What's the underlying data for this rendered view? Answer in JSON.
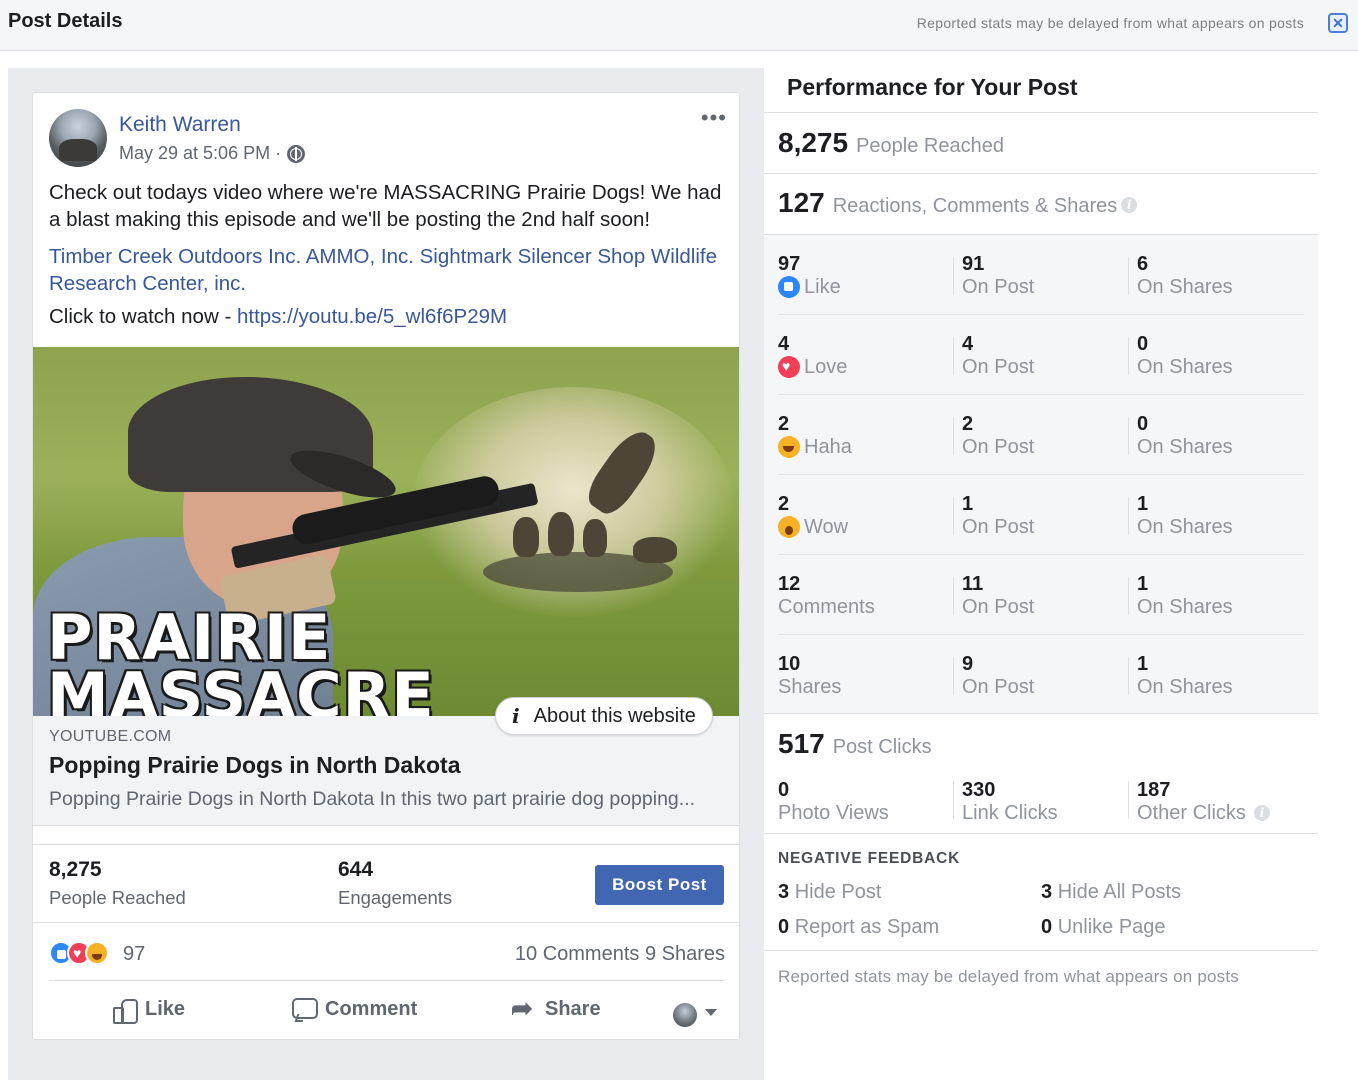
{
  "header": {
    "title": "Post Details",
    "note": "Reported stats may be delayed from what appears on posts",
    "close_icon": "close-icon"
  },
  "post": {
    "author": "Keith Warren",
    "timestamp": "May 29 at 5:06 PM ·",
    "more_label": "•••",
    "text": "Check out todays video where we're MASSACRING Prairie Dogs! We had a blast making this episode and we'll be posting the 2nd half soon!",
    "tags": "Timber Creek Outdoors Inc. AMMO, Inc. Sightmark Silencer Shop Wildlife Research Center, inc.",
    "watch_prefix": "Click to watch now - ",
    "watch_link": "https://youtu.be/5_wl6f6P29M",
    "thumbnail_text_line1": "PRAIRIE",
    "thumbnail_text_line2": "MASSACRE",
    "about_website": "About this website",
    "link": {
      "domain": "YOUTUBE.COM",
      "title": "Popping Prairie Dogs in North Dakota",
      "description": "Popping Prairie Dogs in North Dakota In this two part prairie dog popping..."
    },
    "stats": {
      "reached_value": "8,275",
      "reached_label": "People Reached",
      "engagements_value": "644",
      "engagements_label": "Engagements",
      "boost_label": "Boost Post"
    },
    "reactions_count": "97",
    "comments_shares": "10 Comments  9 Shares",
    "actions": {
      "like": "Like",
      "comment": "Comment",
      "share": "Share"
    }
  },
  "performance": {
    "title": "Performance for Your Post",
    "reached_value": "8,275",
    "reached_label": "People Reached",
    "engagement_value": "127",
    "engagement_label": "Reactions, Comments & Shares",
    "breakdown": [
      {
        "total": "97",
        "label": "Like",
        "icon": "like",
        "on_post": "91",
        "on_post_label": "On Post",
        "on_shares": "6",
        "on_shares_label": "On Shares"
      },
      {
        "total": "4",
        "label": "Love",
        "icon": "love",
        "on_post": "4",
        "on_post_label": "On Post",
        "on_shares": "0",
        "on_shares_label": "On Shares"
      },
      {
        "total": "2",
        "label": "Haha",
        "icon": "haha",
        "on_post": "2",
        "on_post_label": "On Post",
        "on_shares": "0",
        "on_shares_label": "On Shares"
      },
      {
        "total": "2",
        "label": "Wow",
        "icon": "wow",
        "on_post": "1",
        "on_post_label": "On Post",
        "on_shares": "1",
        "on_shares_label": "On Shares"
      },
      {
        "total": "12",
        "label": "Comments",
        "icon": "",
        "on_post": "11",
        "on_post_label": "On Post",
        "on_shares": "1",
        "on_shares_label": "On Shares"
      },
      {
        "total": "10",
        "label": "Shares",
        "icon": "",
        "on_post": "9",
        "on_post_label": "On Post",
        "on_shares": "1",
        "on_shares_label": "On Shares"
      }
    ],
    "clicks_value": "517",
    "clicks_label": "Post Clicks",
    "clicks": {
      "photo_views_value": "0",
      "photo_views_label": "Photo Views",
      "link_clicks_value": "330",
      "link_clicks_label": "Link Clicks",
      "other_clicks_value": "187",
      "other_clicks_label": "Other Clicks"
    },
    "negative": {
      "title": "NEGATIVE FEEDBACK",
      "hide_post_value": "3",
      "hide_post_label": "Hide Post",
      "hide_all_value": "3",
      "hide_all_label": "Hide All Posts",
      "spam_value": "0",
      "spam_label": "Report as Spam",
      "unlike_value": "0",
      "unlike_label": "Unlike Page"
    },
    "footer_note": "Reported stats may be delayed from what appears on posts"
  },
  "colors": {
    "link_blue": "#385898",
    "boost_blue": "#4267b2",
    "like_blue": "#2d88ff",
    "love_red": "#f33e58",
    "haha_yellow": "#f7b125"
  }
}
